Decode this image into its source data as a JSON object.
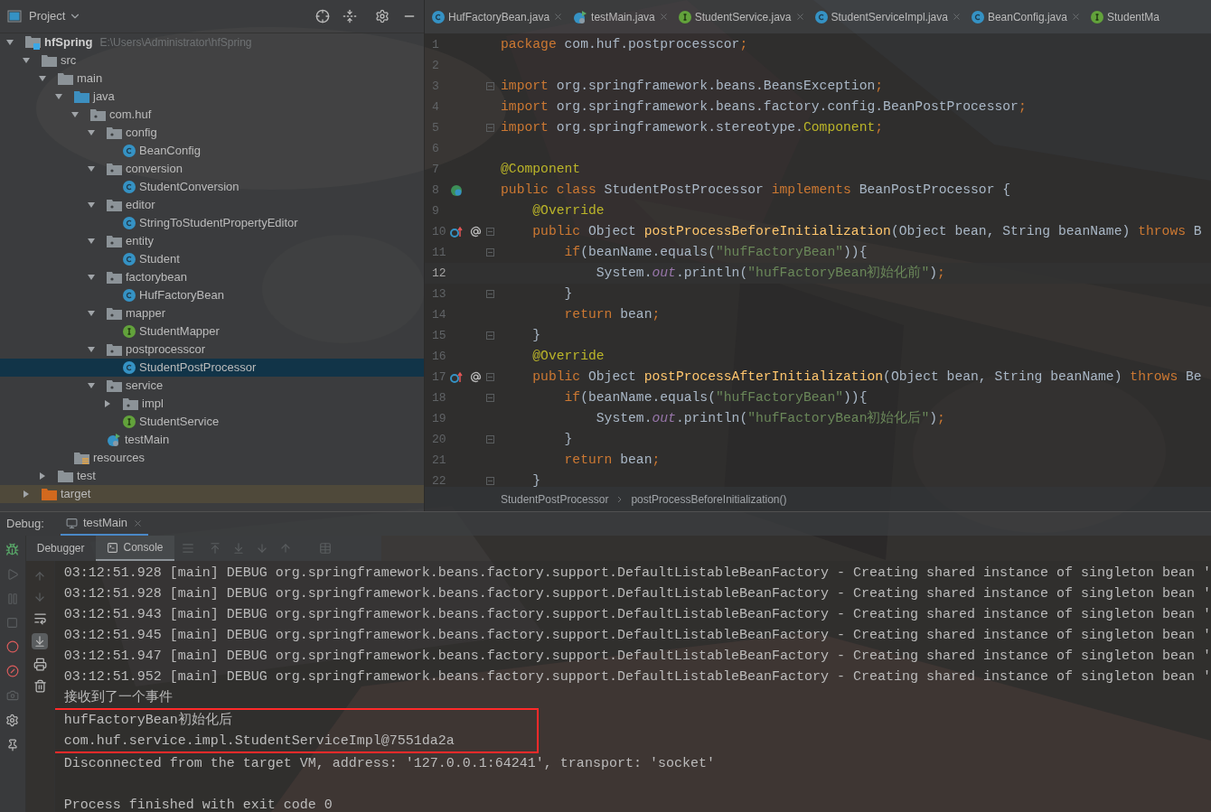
{
  "project_panel": {
    "title": "Project",
    "tree": [
      {
        "label": "hfSpring",
        "path": "E:\\Users\\Administrator\\hfSpring",
        "kind": "module",
        "expanded": true,
        "selected": false,
        "children": [
          {
            "label": "src",
            "kind": "folder",
            "expanded": true,
            "selected": false,
            "children": [
              {
                "label": "main",
                "kind": "folder",
                "expanded": true,
                "selected": false,
                "children": [
                  {
                    "label": "java",
                    "kind": "source",
                    "expanded": true,
                    "selected": false,
                    "children": [
                      {
                        "label": "com.huf",
                        "kind": "package",
                        "expanded": true,
                        "selected": false,
                        "children": [
                          {
                            "label": "config",
                            "kind": "package",
                            "expanded": true,
                            "selected": false,
                            "children": [
                              {
                                "label": "BeanConfig",
                                "kind": "class",
                                "selected": false
                              }
                            ]
                          },
                          {
                            "label": "conversion",
                            "kind": "package",
                            "expanded": true,
                            "selected": false,
                            "children": [
                              {
                                "label": "StudentConversion",
                                "kind": "class",
                                "selected": false
                              }
                            ]
                          },
                          {
                            "label": "editor",
                            "kind": "package",
                            "expanded": true,
                            "selected": false,
                            "children": [
                              {
                                "label": "StringToStudentPropertyEditor",
                                "kind": "class",
                                "selected": false
                              }
                            ]
                          },
                          {
                            "label": "entity",
                            "kind": "package",
                            "expanded": true,
                            "selected": false,
                            "children": [
                              {
                                "label": "Student",
                                "kind": "class",
                                "selected": false
                              }
                            ]
                          },
                          {
                            "label": "factorybean",
                            "kind": "package",
                            "expanded": true,
                            "selected": false,
                            "children": [
                              {
                                "label": "HufFactoryBean",
                                "kind": "class",
                                "selected": false
                              }
                            ]
                          },
                          {
                            "label": "mapper",
                            "kind": "package",
                            "expanded": true,
                            "selected": false,
                            "children": [
                              {
                                "label": "StudentMapper",
                                "kind": "interface",
                                "selected": false
                              }
                            ]
                          },
                          {
                            "label": "postprocesscor",
                            "kind": "package",
                            "expanded": true,
                            "selected": false,
                            "children": [
                              {
                                "label": "StudentPostProcessor",
                                "kind": "class",
                                "selected": true
                              }
                            ]
                          },
                          {
                            "label": "service",
                            "kind": "package",
                            "expanded": true,
                            "selected": false,
                            "children": [
                              {
                                "label": "impl",
                                "kind": "package",
                                "expanded": false,
                                "selected": false
                              },
                              {
                                "label": "StudentService",
                                "kind": "interface",
                                "selected": false
                              }
                            ]
                          },
                          {
                            "label": "testMain",
                            "kind": "runnable",
                            "selected": false
                          }
                        ]
                      }
                    ]
                  },
                  {
                    "label": "resources",
                    "kind": "resources",
                    "selected": false
                  }
                ]
              },
              {
                "label": "test",
                "kind": "folder",
                "expanded": false,
                "selected": false
              }
            ]
          },
          {
            "label": "target",
            "kind": "excluded",
            "expanded": false,
            "selected": false
          }
        ]
      }
    ]
  },
  "editor_tabs": [
    {
      "label": "HufFactoryBean.java",
      "kind": "class",
      "closable": true
    },
    {
      "label": "testMain.java",
      "kind": "runnable",
      "closable": true
    },
    {
      "label": "StudentService.java",
      "kind": "interface",
      "closable": true
    },
    {
      "label": "StudentServiceImpl.java",
      "kind": "class",
      "closable": true
    },
    {
      "label": "BeanConfig.java",
      "kind": "class",
      "closable": true
    },
    {
      "label": "StudentMa",
      "kind": "interface",
      "closable": false
    }
  ],
  "code": [
    {
      "number": "1",
      "current": false,
      "fold": false,
      "tokens": [
        {
          "kind": "kw",
          "text": "package"
        },
        {
          "kind": "plain",
          "text": " com.huf.postprocesscor"
        },
        {
          "kind": "kw",
          "text": ";"
        }
      ]
    },
    {
      "number": "2",
      "current": false,
      "fold": false
    },
    {
      "number": "3",
      "current": false,
      "fold": true,
      "tokens": [
        {
          "kind": "kw",
          "text": "import"
        },
        {
          "kind": "plain",
          "text": " org.springframework.beans.BeansException"
        },
        {
          "kind": "kw",
          "text": ";"
        }
      ]
    },
    {
      "number": "4",
      "current": false,
      "fold": false,
      "tokens": [
        {
          "kind": "kw",
          "text": "import"
        },
        {
          "kind": "plain",
          "text": " org.springframework.beans.factory.config.BeanPostProcessor"
        },
        {
          "kind": "kw",
          "text": ";"
        }
      ]
    },
    {
      "number": "5",
      "current": false,
      "fold": true,
      "tokens": [
        {
          "kind": "kw",
          "text": "import"
        },
        {
          "kind": "plain",
          "text": " org.springframework.stereotype."
        },
        {
          "kind": "ann",
          "text": "Component"
        },
        {
          "kind": "kw",
          "text": ";"
        }
      ]
    },
    {
      "number": "6",
      "current": false,
      "fold": false
    },
    {
      "number": "7",
      "current": false,
      "fold": false,
      "tokens": [
        {
          "kind": "ann",
          "text": "@Component"
        }
      ]
    },
    {
      "number": "8",
      "current": false,
      "fold": false,
      "kind": "bean",
      "tokens": [
        {
          "kind": "kw",
          "text": "public class"
        },
        {
          "kind": "plain",
          "text": " StudentPostProcessor "
        },
        {
          "kind": "kw",
          "text": "implements"
        },
        {
          "kind": "plain",
          "text": " BeanPostProcessor {"
        }
      ]
    },
    {
      "number": "9",
      "current": false,
      "fold": false,
      "tokens": [
        {
          "kind": "ann",
          "text": "    @Override"
        }
      ]
    },
    {
      "number": "10",
      "current": false,
      "fold": true,
      "kind": "override",
      "tokens": [
        {
          "kind": "kw",
          "text": "    public"
        },
        {
          "kind": "plain",
          "text": " Object "
        },
        {
          "kind": "method",
          "text": "postProcessBeforeInitialization"
        },
        {
          "kind": "plain",
          "text": "(Object bean, String beanName) "
        },
        {
          "kind": "kw",
          "text": "throws"
        },
        {
          "kind": "plain",
          "text": " B"
        }
      ]
    },
    {
      "number": "11",
      "current": false,
      "fold": true,
      "tokens": [
        {
          "kind": "kw",
          "text": "        if"
        },
        {
          "kind": "plain",
          "text": "(beanName.equals("
        },
        {
          "kind": "str",
          "text": "\"hufFactoryBean\""
        },
        {
          "kind": "plain",
          "text": ")){"
        }
      ]
    },
    {
      "number": "12",
      "current": true,
      "fold": false,
      "tokens": [
        {
          "kind": "plain",
          "text": "            System."
        },
        {
          "kind": "field",
          "text": "out"
        },
        {
          "kind": "plain",
          "text": ".println("
        },
        {
          "kind": "str",
          "text": "\"hufFactoryBean初始化前\""
        },
        {
          "kind": "plain",
          "text": ")"
        },
        {
          "kind": "kw",
          "text": ";"
        }
      ]
    },
    {
      "number": "13",
      "current": false,
      "fold": true,
      "tokens": [
        {
          "kind": "plain",
          "text": "        }"
        }
      ]
    },
    {
      "number": "14",
      "current": false,
      "fold": false,
      "tokens": [
        {
          "kind": "kw",
          "text": "        return"
        },
        {
          "kind": "plain",
          "text": " bean"
        },
        {
          "kind": "kw",
          "text": ";"
        }
      ]
    },
    {
      "number": "15",
      "current": false,
      "fold": true,
      "tokens": [
        {
          "kind": "plain",
          "text": "    }"
        }
      ]
    },
    {
      "number": "16",
      "current": false,
      "fold": false,
      "tokens": [
        {
          "kind": "ann",
          "text": "    @Override"
        }
      ]
    },
    {
      "number": "17",
      "current": false,
      "fold": true,
      "kind": "override",
      "tokens": [
        {
          "kind": "kw",
          "text": "    public"
        },
        {
          "kind": "plain",
          "text": " Object "
        },
        {
          "kind": "method",
          "text": "postProcessAfterInitialization"
        },
        {
          "kind": "plain",
          "text": "(Object bean, String beanName) "
        },
        {
          "kind": "kw",
          "text": "throws"
        },
        {
          "kind": "plain",
          "text": " Be"
        }
      ]
    },
    {
      "number": "18",
      "current": false,
      "fold": true,
      "tokens": [
        {
          "kind": "kw",
          "text": "        if"
        },
        {
          "kind": "plain",
          "text": "(beanName.equals("
        },
        {
          "kind": "str",
          "text": "\"hufFactoryBean\""
        },
        {
          "kind": "plain",
          "text": ")){"
        }
      ]
    },
    {
      "number": "19",
      "current": false,
      "fold": false,
      "tokens": [
        {
          "kind": "plain",
          "text": "            System."
        },
        {
          "kind": "field",
          "text": "out"
        },
        {
          "kind": "plain",
          "text": ".println("
        },
        {
          "kind": "str",
          "text": "\"hufFactoryBean初始化后\""
        },
        {
          "kind": "plain",
          "text": ")"
        },
        {
          "kind": "kw",
          "text": ";"
        }
      ]
    },
    {
      "number": "20",
      "current": false,
      "fold": true,
      "tokens": [
        {
          "kind": "plain",
          "text": "        }"
        }
      ]
    },
    {
      "number": "21",
      "current": false,
      "fold": false,
      "tokens": [
        {
          "kind": "kw",
          "text": "        return"
        },
        {
          "kind": "plain",
          "text": " bean"
        },
        {
          "kind": "kw",
          "text": ";"
        }
      ]
    },
    {
      "number": "22",
      "current": false,
      "fold": true,
      "tokens": [
        {
          "kind": "plain",
          "text": "    }"
        }
      ]
    }
  ],
  "breadcrumb": [
    "StudentPostProcessor",
    "postProcessBeforeInitialization()"
  ],
  "debug": {
    "label": "Debug:",
    "tab": "testMain",
    "subtabs": [
      {
        "label": "Debugger",
        "selected": false
      },
      {
        "label": "Console",
        "selected": true
      }
    ],
    "console": {
      "lines_before": [
        "03:12:51.928 [main] DEBUG org.springframework.beans.factory.support.DefaultListableBeanFactory - Creating shared instance of singleton bean '",
        "03:12:51.928 [main] DEBUG org.springframework.beans.factory.support.DefaultListableBeanFactory - Creating shared instance of singleton bean '",
        "03:12:51.943 [main] DEBUG org.springframework.beans.factory.support.DefaultListableBeanFactory - Creating shared instance of singleton bean '",
        "03:12:51.945 [main] DEBUG org.springframework.beans.factory.support.DefaultListableBeanFactory - Creating shared instance of singleton bean '",
        "03:12:51.947 [main] DEBUG org.springframework.beans.factory.support.DefaultListableBeanFactory - Creating shared instance of singleton bean '",
        "03:12:51.952 [main] DEBUG org.springframework.beans.factory.support.DefaultListableBeanFactory - Creating shared instance of singleton bean '",
        "接收到了一个事件"
      ],
      "highlighted": [
        "hufFactoryBean初始化后",
        "com.huf.service.impl.StudentServiceImpl@7551da2a"
      ],
      "lines_after": [
        "Disconnected from the target VM, address: '127.0.0.1:64241', transport: 'socket'"
      ],
      "exit_message": "Process finished with exit code 0"
    }
  }
}
